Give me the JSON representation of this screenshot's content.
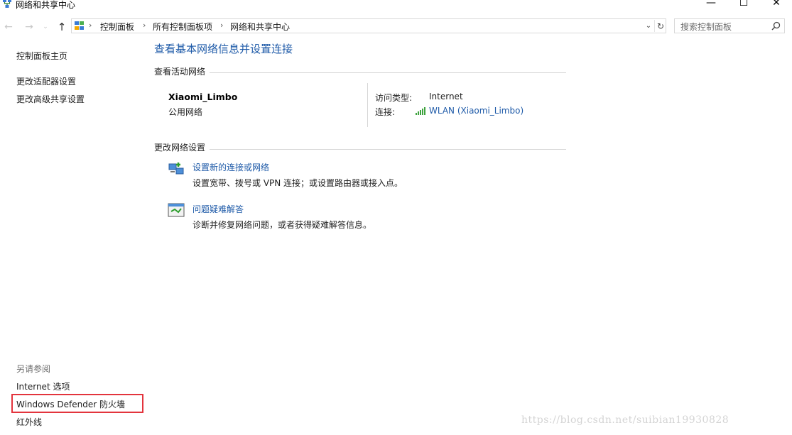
{
  "window": {
    "title": "网络和共享中心",
    "minimize_glyph": "—",
    "maximize_glyph": "☐",
    "close_glyph": "✕"
  },
  "nav": {
    "back_glyph": "←",
    "forward_glyph": "→",
    "recent_glyph": "⌄",
    "up_glyph": "↑"
  },
  "address": {
    "sep_glyph": "›",
    "crumbs": [
      "控制面板",
      "所有控制面板项",
      "网络和共享中心"
    ],
    "dropdown_glyph": "⌄",
    "refresh_glyph": "↻"
  },
  "search": {
    "placeholder": "搜索控制面板"
  },
  "sidebar": {
    "home": "控制面板主页",
    "links": [
      "更改适配器设置",
      "更改高级共享设置"
    ],
    "see_also_heading": "另请参阅",
    "see_also": [
      "Internet 选项",
      "Windows Defender 防火墙",
      "红外线"
    ]
  },
  "main": {
    "title": "查看基本网络信息并设置连接",
    "active_networks": {
      "heading": "查看活动网络",
      "network_name": "Xiaomi_Limbo",
      "network_type": "公用网络",
      "access_type_label": "访问类型:",
      "access_type_value": "Internet",
      "connection_label": "连接:",
      "connection_value": "WLAN (Xiaomi_Limbo)"
    },
    "change_settings": {
      "heading": "更改网络设置",
      "tasks": [
        {
          "title": "设置新的连接或网络",
          "description": "设置宽带、拨号或 VPN 连接；或设置路由器或接入点。",
          "icon": "new-connection-icon"
        },
        {
          "title": "问题疑难解答",
          "description": "诊断并修复网络问题，或者获得疑难解答信息。",
          "icon": "troubleshoot-icon"
        }
      ]
    }
  },
  "watermark": "https://blog.csdn.net/suibian19930828",
  "colors": {
    "link": "#1e5aa8",
    "highlight_box": "#e3343d"
  }
}
